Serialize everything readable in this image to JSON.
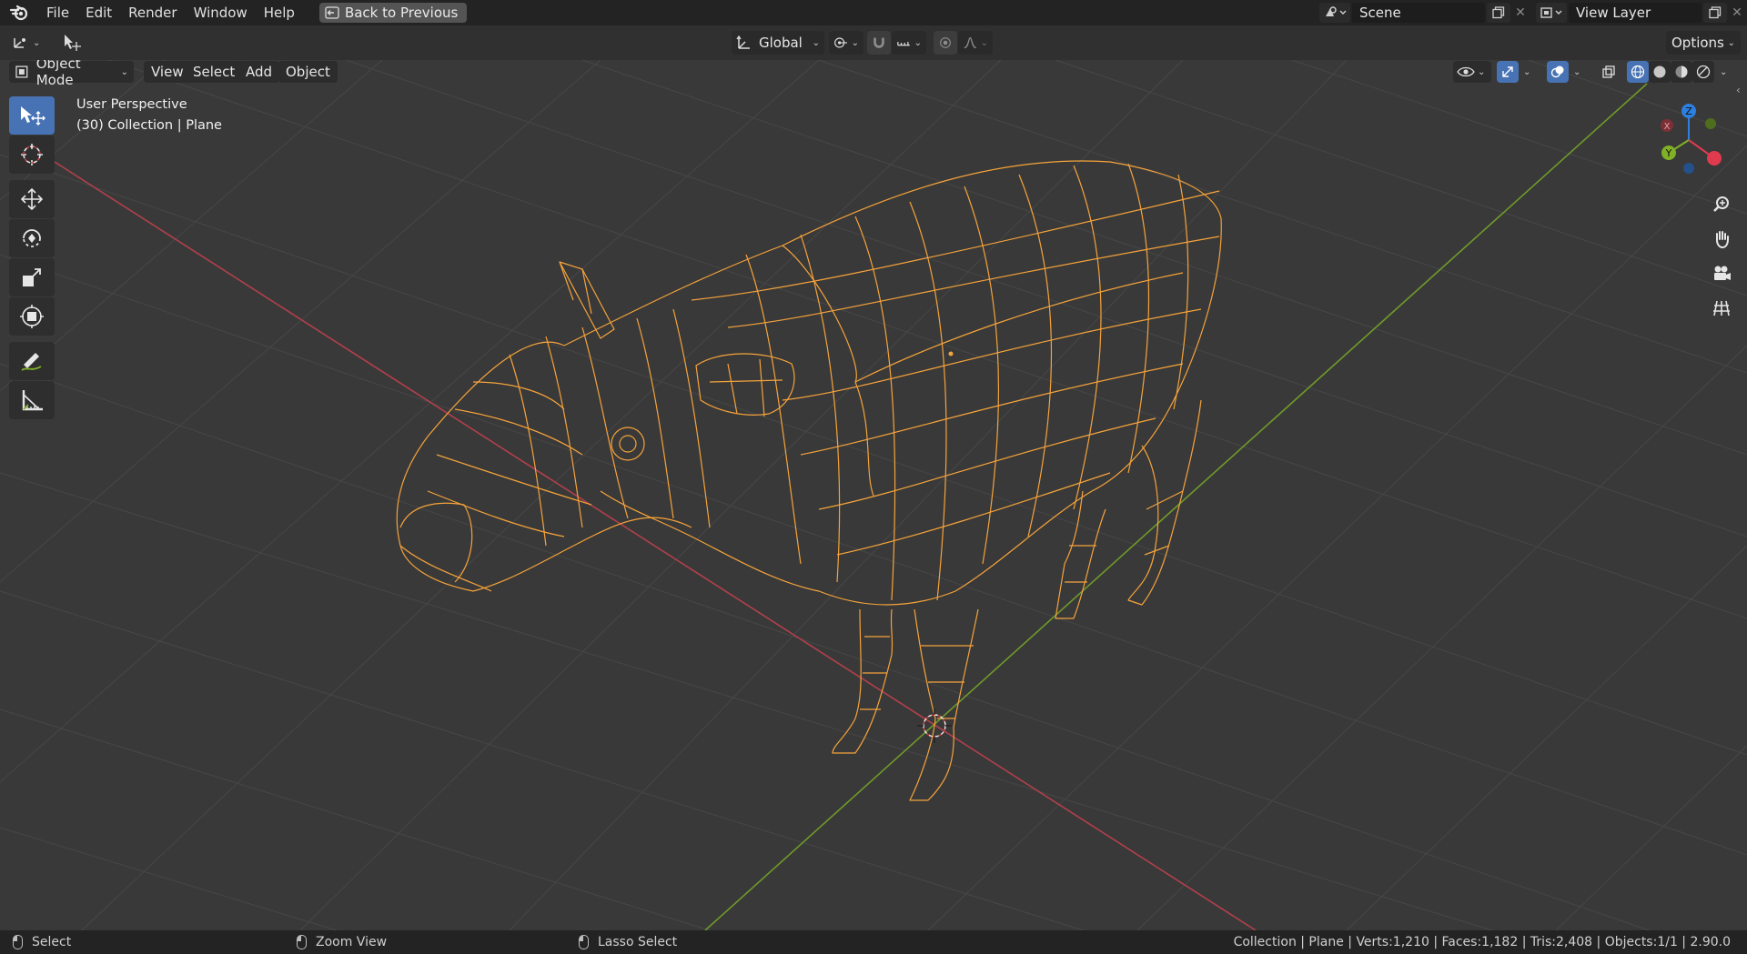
{
  "menubar": {
    "logo": "blender-logo",
    "items": [
      "File",
      "Edit",
      "Render",
      "Window",
      "Help"
    ],
    "back_button": "Back to Previous",
    "scene_name": "Scene",
    "view_layer_name": "View Layer"
  },
  "tool_header": {
    "orientation": "Global",
    "options": "Options"
  },
  "viewport_header": {
    "mode": "Object Mode",
    "menus": [
      "View",
      "Select",
      "Add",
      "Object"
    ]
  },
  "viewport": {
    "perspective": "User Perspective",
    "collection_info": "(30) Collection | Plane",
    "gizmo": {
      "x": "X",
      "y": "Y",
      "z": "Z"
    },
    "colors": {
      "background": "#393939",
      "grid": "#4a4a4a",
      "x_axis": "#c2404e",
      "y_axis": "#7ca82a",
      "wire": "#f5a33b"
    }
  },
  "toolbar": {
    "tools": [
      "select-box",
      "cursor",
      "move",
      "rotate",
      "scale",
      "transform",
      "annotate",
      "measure"
    ]
  },
  "statusbar": {
    "select": "Select",
    "zoom": "Zoom View",
    "lasso": "Lasso Select",
    "stats": "Collection | Plane | Verts:1,210 | Faces:1,182 | Tris:2,408 | Objects:1/1 | 2.90.0"
  }
}
